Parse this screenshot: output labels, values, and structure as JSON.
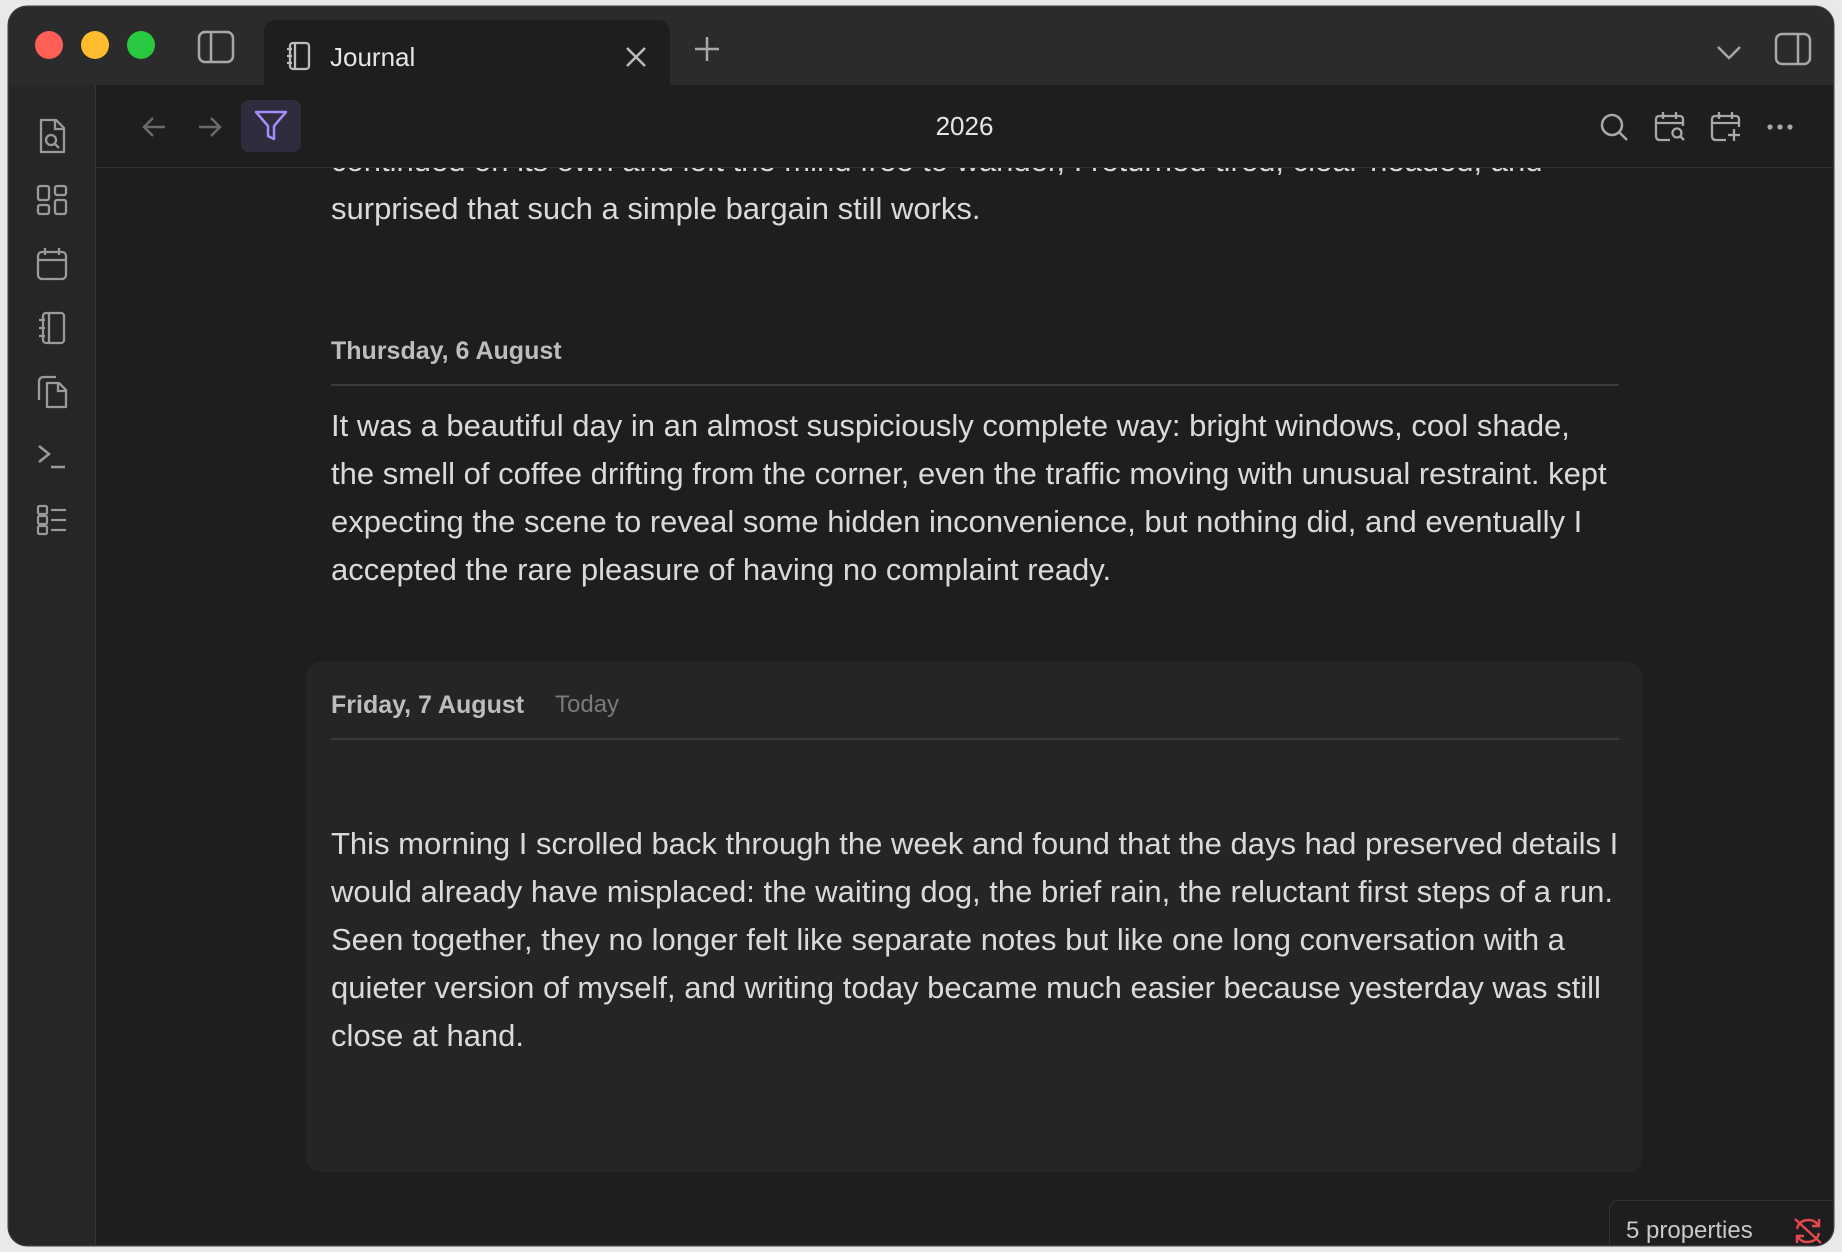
{
  "tab": {
    "label": "Journal",
    "icon": "journal-icon"
  },
  "header": {
    "title": "2026"
  },
  "ribbon": {
    "items": [
      "search-note-icon",
      "dashboard-icon",
      "calendar-icon",
      "journal-icon",
      "copy-icon",
      "terminal-icon",
      "list-icon"
    ]
  },
  "entries": {
    "previous_tail": "continued on its own and left the mind free to wander, I returned tired, clear-headed, and surprised that such a simple bargain still works.",
    "thursday": {
      "date": "Thursday, 6 August",
      "text": "It was a beautiful day in an almost suspiciously complete way: bright windows, cool shade, the smell of coffee drifting from the corner, even the traffic moving with unusual restraint. kept expecting the scene to reveal some hidden inconvenience, but nothing did, and eventually I accepted the rare pleasure of having no complaint ready."
    },
    "friday": {
      "date": "Friday, 7 August",
      "badge": "Today",
      "text": "This morning I scrolled back through the week and found that the days had preserved details I would already have misplaced: the waiting dog, the brief rain, the reluctant first steps of a run. Seen together, they no longer felt like separate notes but like one long conversation with a quieter version of myself, and writing today became much easier because yesterday was still close at hand."
    }
  },
  "status": {
    "properties_label": "5 properties",
    "sync_icon": "sync-off-icon"
  },
  "colors": {
    "accent": "#a78bfa",
    "sync_error": "#e5484d",
    "background": "#1e1e1e"
  }
}
